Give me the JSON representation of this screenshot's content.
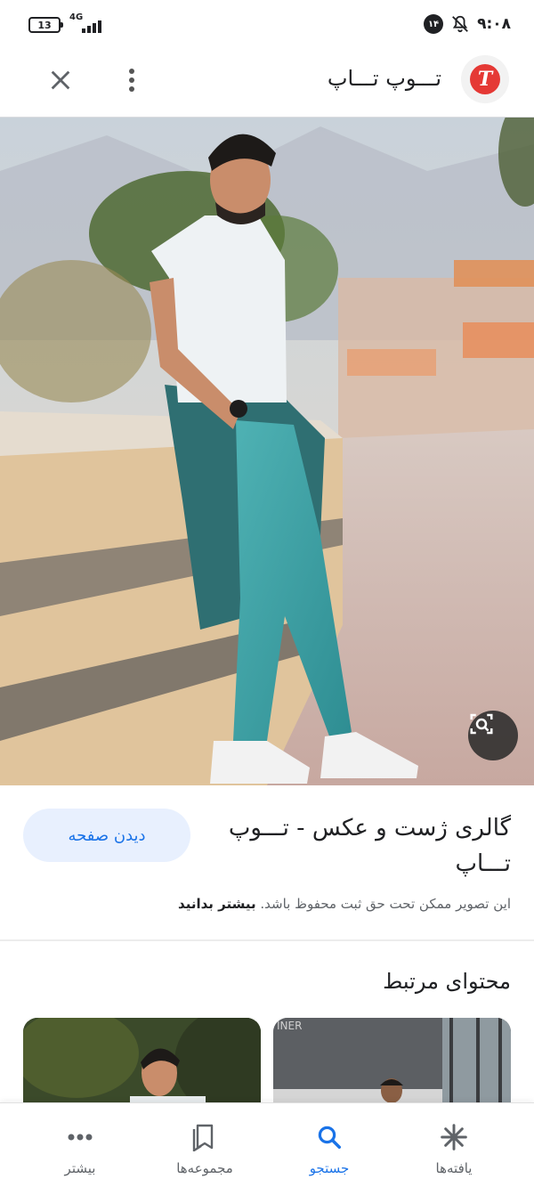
{
  "status_bar": {
    "battery": "13",
    "network": "4G",
    "notification_count": "۱۴",
    "time": "۹:۰۸"
  },
  "header": {
    "site_name": "تـــوپ تـــاپ",
    "logo_letter": "T"
  },
  "hero": {
    "overlay_text": "INER"
  },
  "result": {
    "title": "گالری ژست و عکس - تـــوپ تـــاپ",
    "visit_button": "دیدن صفحه",
    "copyright_text": "این تصویر ممکن تحت حق ثبت محفوظ باشد.",
    "learn_more": "بیشتر بدانید"
  },
  "related": {
    "heading": "محتوای مرتبط"
  },
  "bottom_nav": {
    "items": [
      {
        "label": "بیشتر",
        "icon": "more-horiz-icon"
      },
      {
        "label": "مجموعه‌ها",
        "icon": "collections-icon"
      },
      {
        "label": "جستجو",
        "icon": "search-icon"
      },
      {
        "label": "یافته‌ها",
        "icon": "discover-icon"
      }
    ],
    "active": "جستجو",
    "active_color": "#1a73e8"
  }
}
